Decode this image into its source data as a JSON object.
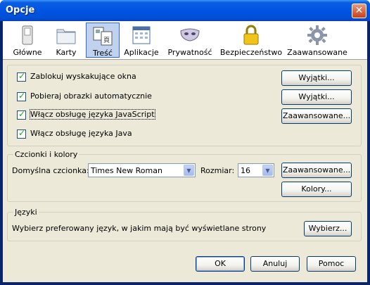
{
  "window": {
    "title": "Opcje",
    "close_glyph": "✕"
  },
  "toolbar": {
    "items": [
      {
        "label": "Główne",
        "icon": "switch-icon"
      },
      {
        "label": "Karty",
        "icon": "folder-tabs-icon"
      },
      {
        "label": "Treść",
        "icon": "content-icon",
        "selected": true
      },
      {
        "label": "Aplikacje",
        "icon": "applications-icon"
      },
      {
        "label": "Prywatność",
        "icon": "mask-icon"
      },
      {
        "label": "Bezpieczeństwo",
        "icon": "padlock-icon"
      },
      {
        "label": "Zaawansowane",
        "icon": "gear-icon"
      }
    ]
  },
  "content": {
    "checkboxes": [
      {
        "label": "Zablokuj wyskakujące okna",
        "checked": true,
        "button": "Wyjątki..."
      },
      {
        "label": "Pobieraj obrazki automatycznie",
        "checked": true,
        "button": "Wyjątki..."
      },
      {
        "label": "Włącz obsługę języka JavaScript",
        "checked": true,
        "button": "Zaawansowane..."
      },
      {
        "label": "Włącz obsługę języka Java",
        "checked": true
      }
    ]
  },
  "fonts": {
    "group_label": "Czcionki i kolory",
    "default_font_label": "Domyślna czcionka:",
    "default_font_value": "Times New Roman",
    "size_label": "Rozmiar:",
    "size_value": "16",
    "advanced_button": "Zaawansowane...",
    "colors_button": "Kolory..."
  },
  "languages": {
    "group_label": "Języki",
    "description": "Wybierz preferowany język, w jakim mają być wyświetlane strony",
    "choose_button": "Wybierz..."
  },
  "footer": {
    "ok": "OK",
    "cancel": "Anuluj",
    "help": "Pomoc"
  },
  "colors": {
    "titlebar": "#0054e3",
    "dialog_bg": "#ece9d8",
    "selected_tab": "#c1d2ee",
    "checkmark": "#21a121"
  }
}
